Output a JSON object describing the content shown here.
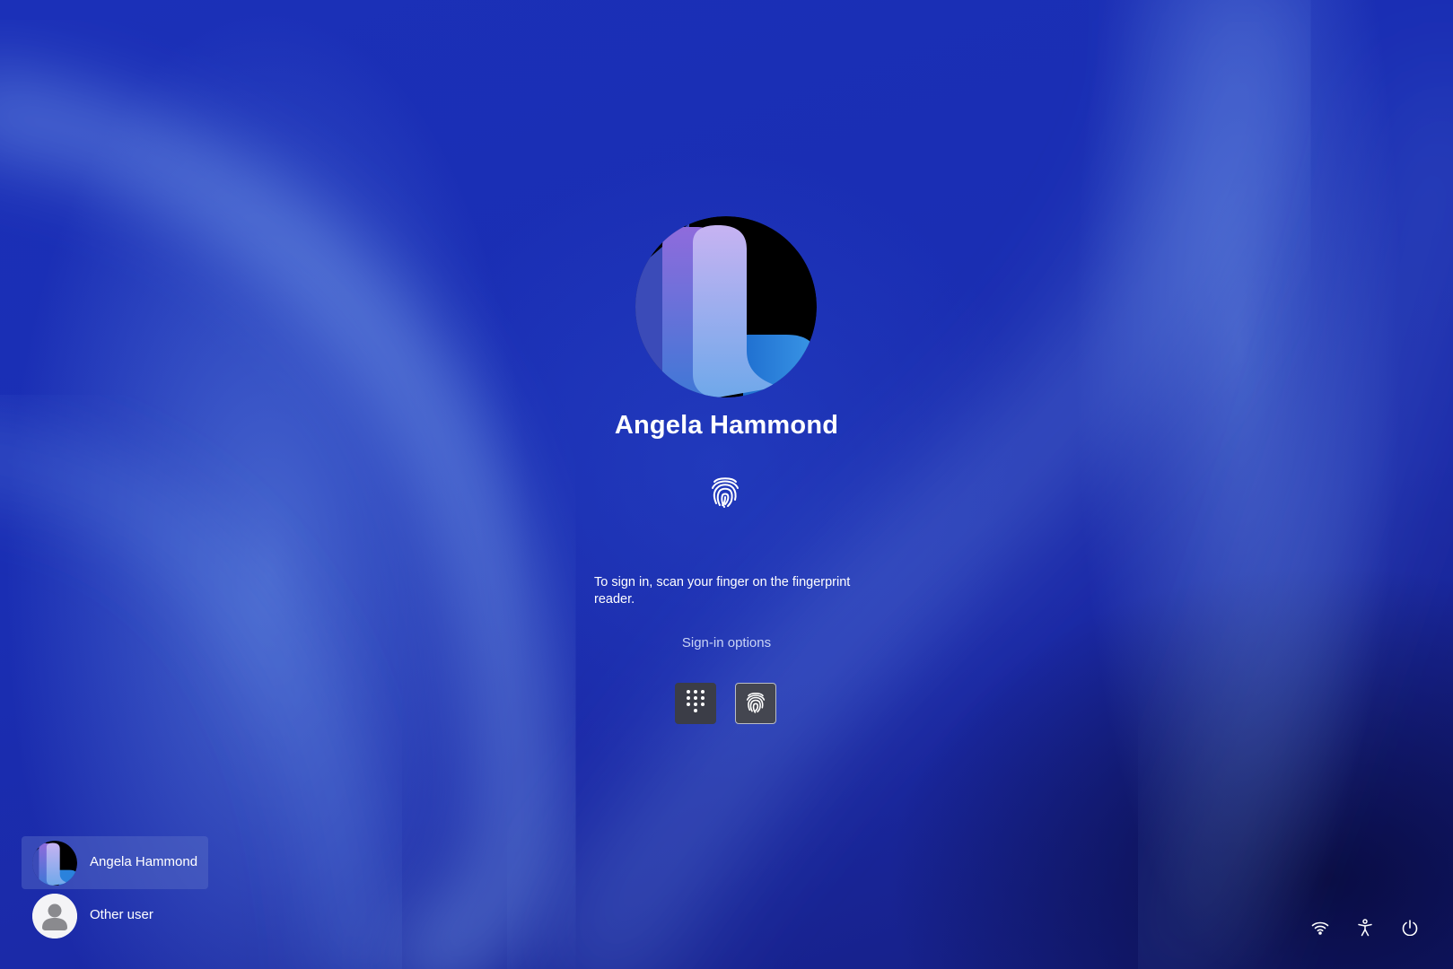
{
  "user": {
    "name": "Angela Hammond"
  },
  "signin": {
    "instruction": "To sign in, scan your finger on the fingerprint reader.",
    "options_link": "Sign-in options",
    "methods": [
      {
        "name": "PIN",
        "icon": "pin-keypad-icon",
        "selected": false
      },
      {
        "name": "Fingerprint",
        "icon": "fingerprint-icon",
        "selected": true
      }
    ]
  },
  "user_list": [
    {
      "name": "Angela Hammond",
      "selected": true,
      "avatar": "brand-avatar"
    },
    {
      "name": "Other user",
      "selected": false,
      "avatar": "generic-person-icon"
    }
  ],
  "tray": {
    "icons": [
      "wifi-icon",
      "accessibility-icon",
      "power-icon"
    ]
  },
  "colors": {
    "background": "#1a2fb0",
    "text": "#ffffff",
    "link": "#c9d4f5",
    "button_bg": "#3b3d47"
  }
}
